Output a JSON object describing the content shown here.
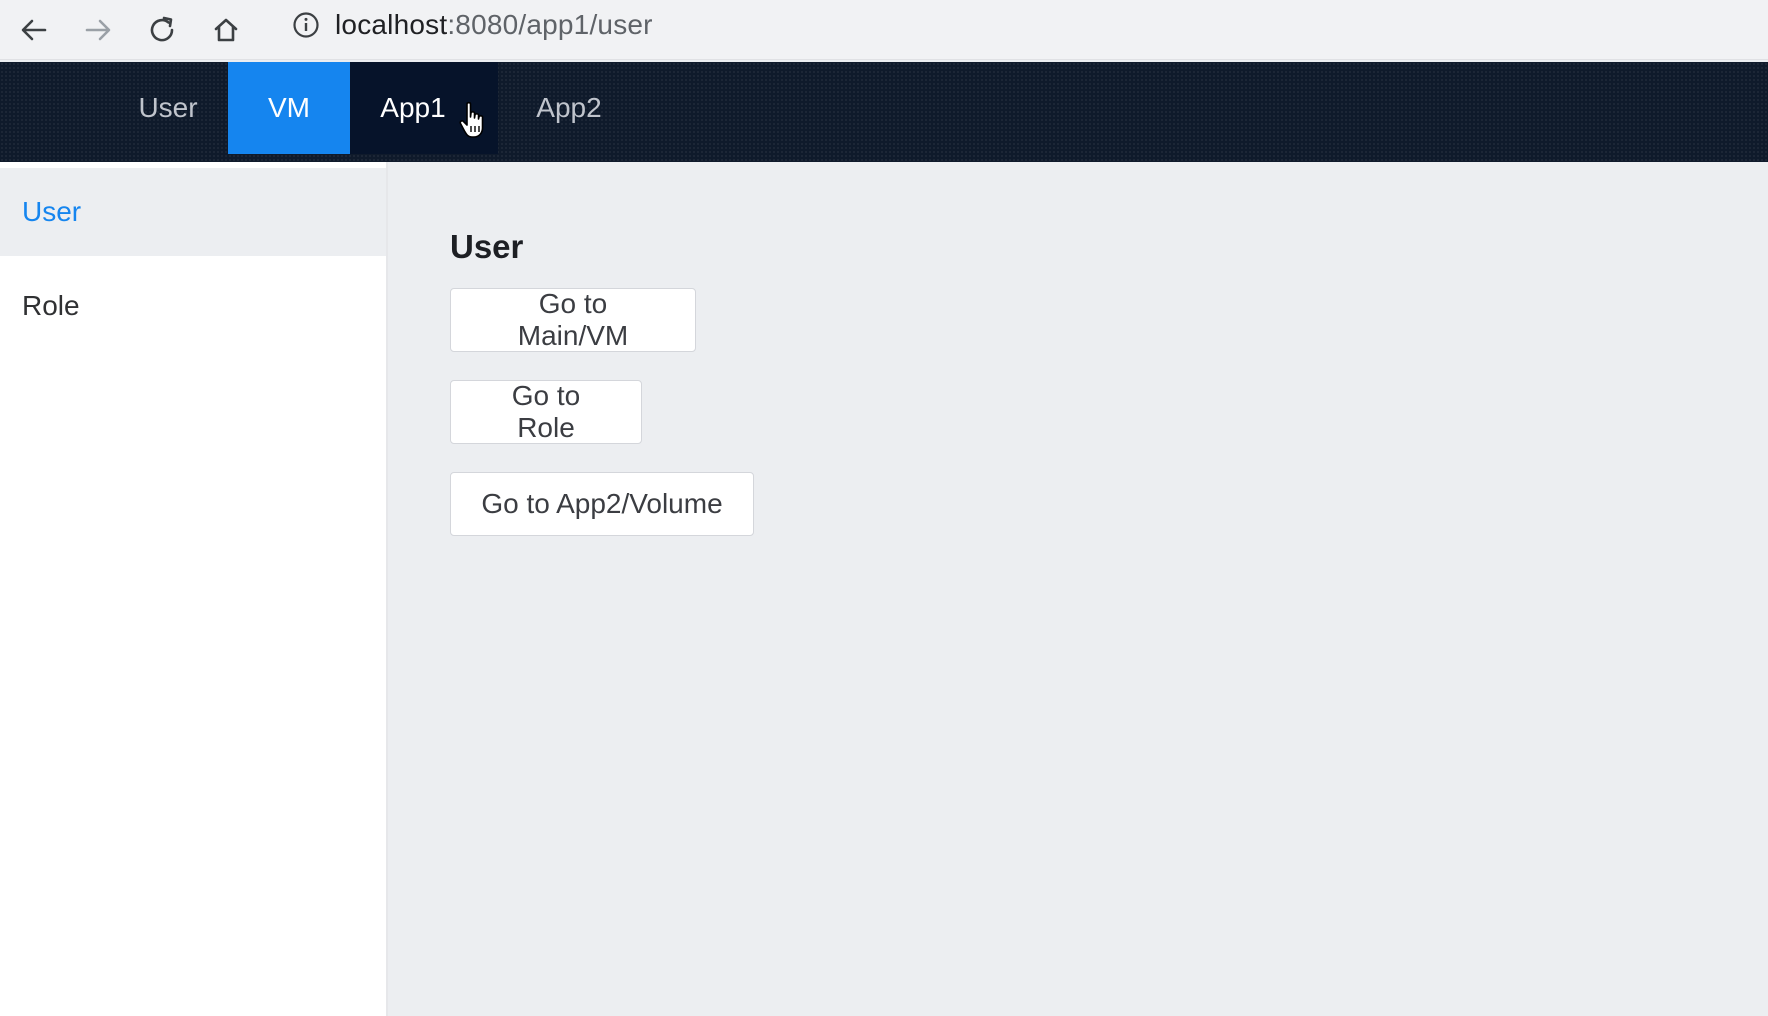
{
  "browser": {
    "url_host": "localhost",
    "url_path": ":8080/app1/user",
    "icons": [
      "back-icon",
      "forward-icon",
      "reload-icon",
      "home-icon",
      "info-icon"
    ]
  },
  "topnav": {
    "tabs": [
      {
        "label": "User",
        "state": "inactive"
      },
      {
        "label": "VM",
        "state": "active"
      },
      {
        "label": "App1",
        "state": "hover"
      },
      {
        "label": "App2",
        "state": "inactive"
      }
    ],
    "colors": {
      "active": "#1585ef",
      "hover": "#06132a",
      "background": "#0f1a2b"
    }
  },
  "sidebar": {
    "items": [
      {
        "label": "User",
        "active": true
      },
      {
        "label": "Role",
        "active": false
      }
    ],
    "accent": "#1585ef"
  },
  "main": {
    "title": "User",
    "buttons": [
      {
        "label": "Go to Main/VM"
      },
      {
        "label": "Go to Role"
      },
      {
        "label": "Go to App2/Volume"
      }
    ]
  }
}
